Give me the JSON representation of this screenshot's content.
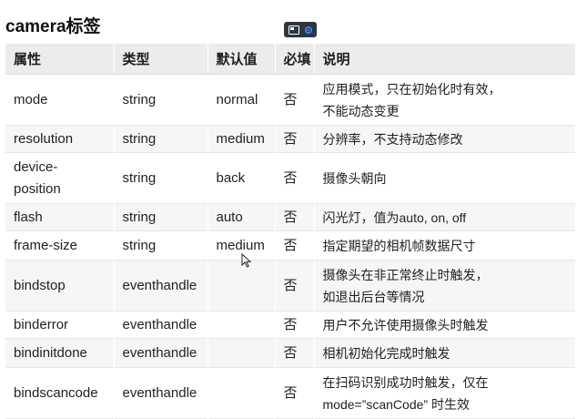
{
  "title": "camera标签",
  "toolbar": {
    "icons": [
      "screen-share-icon",
      "settings-gear-icon"
    ],
    "accent": "#2f3640"
  },
  "table": {
    "headers": [
      "属性",
      "类型",
      "默认值",
      "必填",
      "说明"
    ],
    "rows": [
      {
        "attr": "mode",
        "type": "string",
        "default": "normal",
        "required": "否",
        "desc1": "应用模式，只在初始化时有效，",
        "desc2": "不能动态变更"
      },
      {
        "attr": "resolution",
        "type": "string",
        "default": "medium",
        "required": "否",
        "desc1": "分辨率，不支持动态修改",
        "desc2": ""
      },
      {
        "attr": "device-",
        "attr2": "position",
        "type": "string",
        "default": "back",
        "required": "否",
        "desc1": "摄像头朝向",
        "desc2": ""
      },
      {
        "attr": "flash",
        "type": "string",
        "default": "auto",
        "required": "否",
        "desc1": "闪光灯，值为auto, on, off",
        "desc2": ""
      },
      {
        "attr": "frame-size",
        "type": "string",
        "default": "medium",
        "required": "否",
        "desc1": "指定期望的相机帧数据尺寸",
        "desc2": ""
      },
      {
        "attr": "bindstop",
        "type": "eventhandle",
        "default": "",
        "required": "否",
        "desc1": "摄像头在非正常终止时触发，",
        "desc2": "如退出后台等情况"
      },
      {
        "attr": "binderror",
        "type": "eventhandle",
        "default": "",
        "required": "否",
        "desc1": "用户不允许使用摄像头时触发",
        "desc2": ""
      },
      {
        "attr": "bindinitdone",
        "type": "eventhandle",
        "default": "",
        "required": "否",
        "desc1": "相机初始化完成时触发",
        "desc2": ""
      },
      {
        "attr": "bindscancode",
        "type": "eventhandle",
        "default": "",
        "required": "否",
        "desc1": "在扫码识别成功时触发，仅在",
        "desc2": "mode=”scanCode” 时生效"
      }
    ]
  }
}
